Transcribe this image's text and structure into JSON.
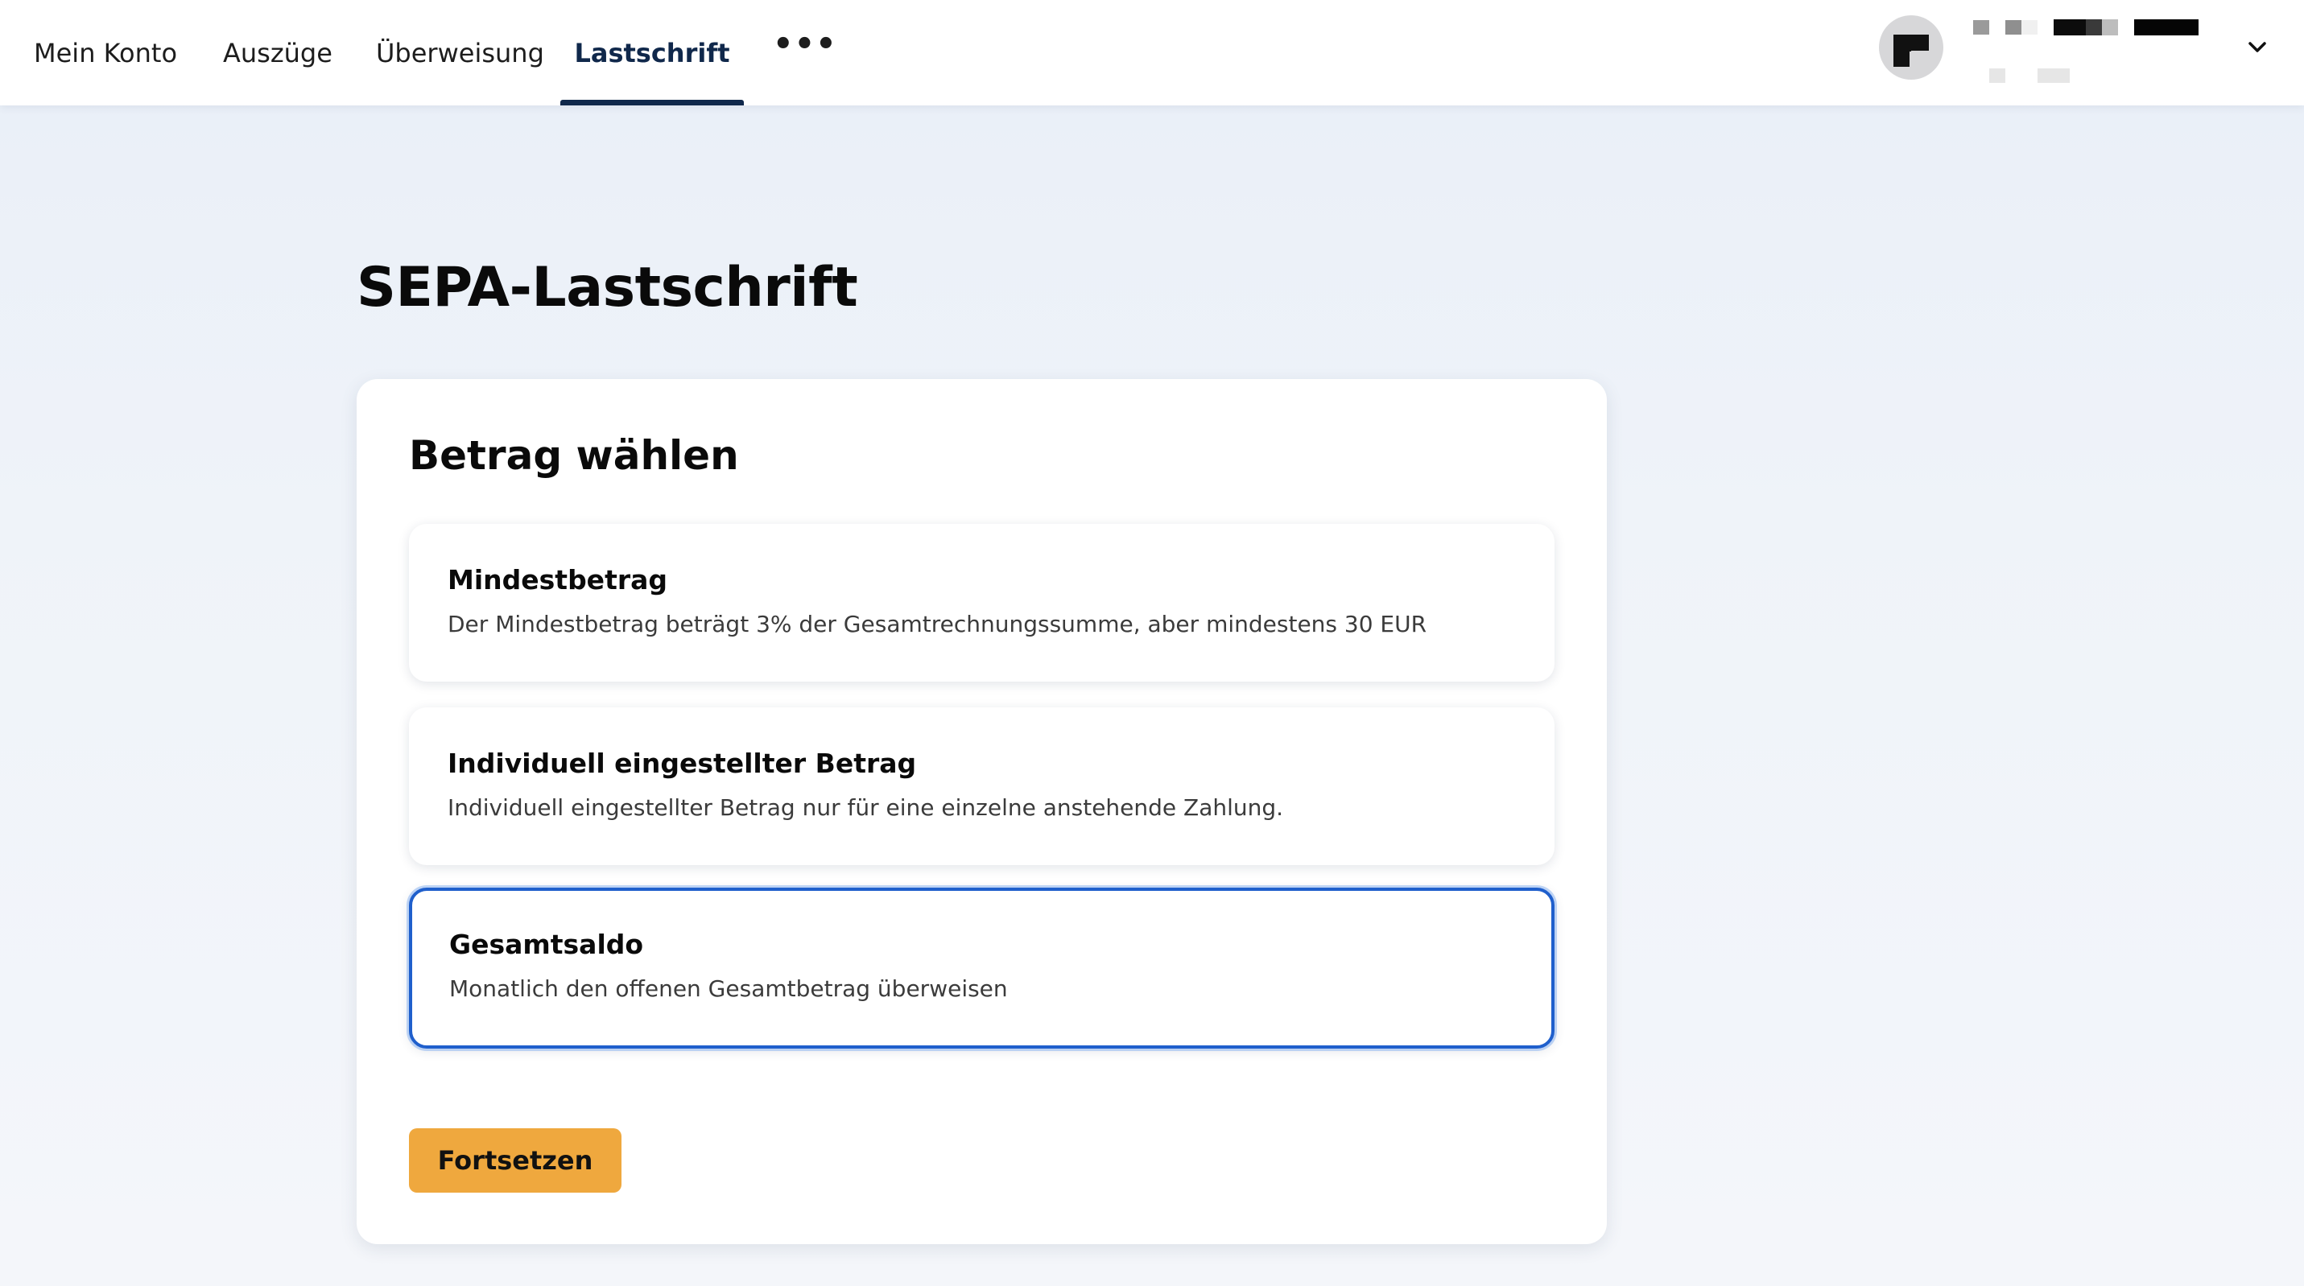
{
  "nav": {
    "items": [
      {
        "label": "Mein Konto"
      },
      {
        "label": "Auszüge"
      },
      {
        "label": "Überweisung"
      },
      {
        "label": "Lastschrift",
        "active": true
      }
    ],
    "more_label": "•••"
  },
  "user": {
    "avatar_icon": "user-avatar-icon",
    "menu_icon": "chevron-down-icon"
  },
  "page": {
    "title": "SEPA-Lastschrift"
  },
  "amount_card": {
    "title": "Betrag wählen",
    "options": [
      {
        "title": "Mindestbetrag",
        "description": "Der Mindestbetrag beträgt 3% der Gesamtrechnungssumme, aber mindestens 30 EUR",
        "selected": false
      },
      {
        "title": "Individuell eingestellter Betrag",
        "description": "Individuell eingestellter Betrag nur für eine einzelne anstehende Zahlung.",
        "selected": false
      },
      {
        "title": "Gesamtsaldo",
        "description": "Monatlich den offenen Gesamtbetrag überweisen",
        "selected": true
      }
    ],
    "continue_label": "Fortsetzen"
  },
  "colors": {
    "accent_navy": "#10284b",
    "selection_blue": "#1f5fcc",
    "button_orange": "#efa83e"
  }
}
